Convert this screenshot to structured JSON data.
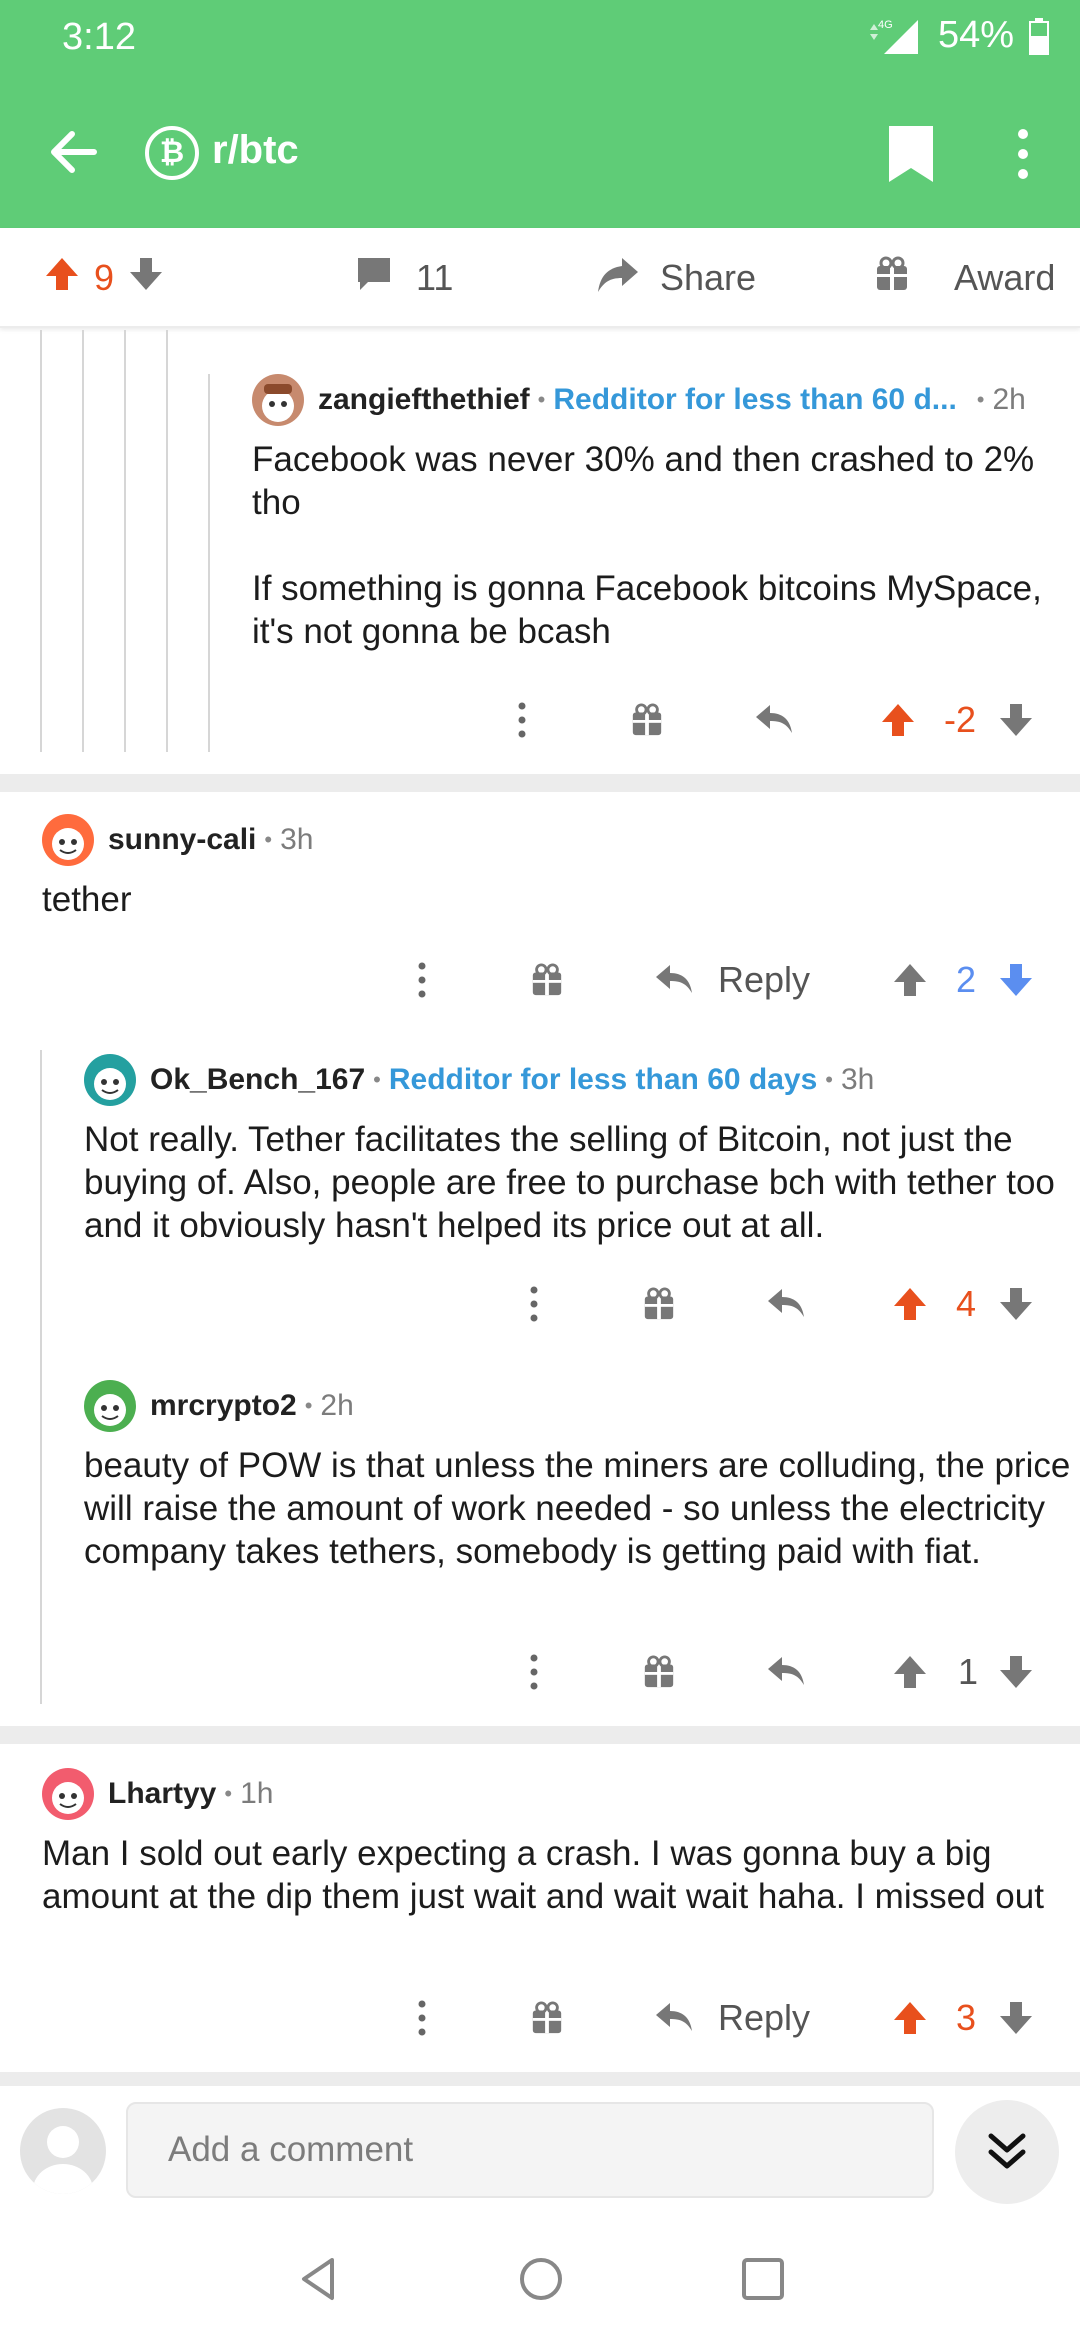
{
  "status": {
    "time": "3:12",
    "network": "4G",
    "battery": "54%"
  },
  "header": {
    "subreddit": "r/btc",
    "sub_icon_glyph": "₿",
    "bg_color": "#5fcc77"
  },
  "post_actions": {
    "score": "9",
    "comments": "11",
    "share_label": "Share",
    "award_label": "Award"
  },
  "comments": [
    {
      "user": "zangiefthethief",
      "flair": "Redditor for less than 60 d...",
      "age": "2h",
      "body": [
        "Facebook was never 30% and then crashed to 2% tho",
        "If something is gonna Facebook bitcoins MySpace, it's not gonna be bcash"
      ],
      "score": "-2"
    },
    {
      "user": "sunny-cali",
      "age": "3h",
      "body": [
        "tether"
      ],
      "reply_label": "Reply",
      "score": "2"
    },
    {
      "user": "Ok_Bench_167",
      "flair": "Redditor for less than 60 days",
      "age": "3h",
      "body": [
        "Not really.  Tether facilitates the selling of Bitcoin, not just the buying of.  Also, people are free to purchase bch with tether too and it obviously hasn't helped its price out at all."
      ],
      "score": "4"
    },
    {
      "user": "mrcrypto2",
      "age": "2h",
      "body": [
        "beauty of POW is that unless the miners are colluding, the price will raise the amount of work needed - so unless the electricity company takes tethers, somebody is getting paid with fiat."
      ],
      "score": "1"
    },
    {
      "user": "Lhartyy",
      "age": "1h",
      "body": [
        "Man I sold out early expecting a crash. I was gonna buy a big amount at the dip them just wait and wait wait haha. I missed out"
      ],
      "reply_label": "Reply",
      "score": "3"
    }
  ],
  "composer": {
    "placeholder": "Add a comment"
  },
  "colors": {
    "upvote": "#e8501d",
    "downvote": "#5b8ef0",
    "flair": "#3598d9"
  }
}
